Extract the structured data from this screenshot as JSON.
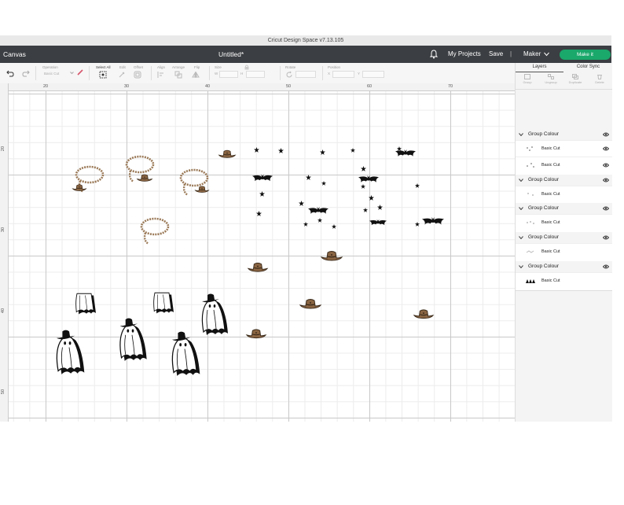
{
  "window": {
    "title": "Cricut Design Space  v7.13.105"
  },
  "topbar": {
    "canvas_label": "Canvas",
    "doc_title": "Untitled*",
    "my_projects": "My Projects",
    "save": "Save",
    "separator": "|",
    "machine": "Maker",
    "make_it": "Make it",
    "accent": "#1aa86b"
  },
  "toolbar": {
    "operation_label": "Operation",
    "operation_value": "Basic Cut",
    "select_all": "Select All",
    "edit": "Edit",
    "offset": "Offset",
    "align": "Align",
    "arrange": "Arrange",
    "flip": "Flip",
    "size": "Size",
    "rotate": "Rotate",
    "position": "Position",
    "w": "W",
    "h": "H",
    "x": "X",
    "y": "Y"
  },
  "ruler": {
    "top": [
      "20",
      "30",
      "40",
      "50",
      "60",
      "70"
    ],
    "left": [
      "20",
      "30",
      "40",
      "50"
    ]
  },
  "panel": {
    "tabs": [
      "Layers",
      "Color Sync"
    ],
    "actions": [
      "Group",
      "Ungroup",
      "Duplicate",
      "Delete"
    ],
    "groups": [
      {
        "title": "Group Colour",
        "layers": [
          "Basic Cut",
          "Basic Cut"
        ]
      },
      {
        "title": "Group Colour",
        "layers": [
          "Basic Cut"
        ]
      },
      {
        "title": "Group Colour",
        "layers": [
          "Basic Cut"
        ]
      },
      {
        "title": "Group Colour",
        "layers": [
          "Basic Cut"
        ]
      },
      {
        "title": "Group Colour",
        "layers": [
          "Basic Cut"
        ]
      }
    ]
  },
  "colors": {
    "hat": "#8a6543",
    "rope": "#9b7a58",
    "ink": "#111111"
  }
}
